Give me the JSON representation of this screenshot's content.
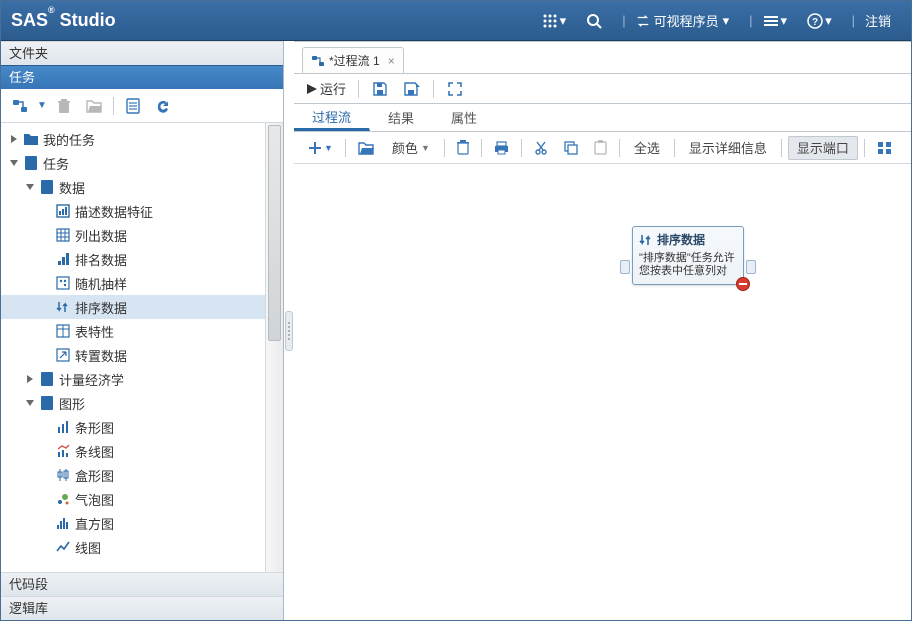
{
  "topbar": {
    "app_name_pre": "SAS",
    "app_name_post": " Studio",
    "role_label": "可视程序员",
    "signout_label": "注销"
  },
  "left_panel": {
    "sections": {
      "folders": "文件夹",
      "tasks": "任务",
      "snippets": "代码段",
      "libraries": "逻辑库"
    },
    "tree": {
      "my_tasks": "我的任务",
      "tasks": "任务",
      "data": "数据",
      "describe_data": "描述数据特征",
      "list_data": "列出数据",
      "rank_data": "排名数据",
      "random_sample": "随机抽样",
      "sort_data": "排序数据",
      "table_attributes": "表特性",
      "transpose_data": "转置数据",
      "econometrics": "计量经济学",
      "graphics": "图形",
      "bar_chart": "条形图",
      "bar_line_chart": "条线图",
      "box_plot": "盒形图",
      "bubble_chart": "气泡图",
      "histogram": "直方图",
      "line_chart": "线图"
    }
  },
  "editor": {
    "tab_label": "*过程流 1",
    "run_label": "运行",
    "subtabs": {
      "flow": "过程流",
      "results": "结果",
      "properties": "属性"
    },
    "flow_toolbar": {
      "color": "颜色",
      "select_all": "全选",
      "show_details": "显示详细信息",
      "show_ports": "显示端口"
    },
    "node": {
      "title": "排序数据",
      "desc": "\"排序数据\"任务允许您按表中任意列对"
    }
  }
}
